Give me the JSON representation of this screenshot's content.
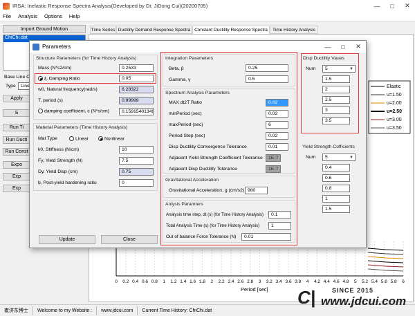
{
  "app": {
    "title": "IRSA: Inelastic Response Spectra Analysis(Developed by Dr. JiDong Cui)(20200705)",
    "menus": [
      "File",
      "Analysis",
      "Options",
      "Help"
    ]
  },
  "left": {
    "import_button": "Import Ground Motion",
    "record": "ChiChi.dat",
    "base_line": "Base Line Co",
    "type_label": "Type",
    "type_value": "Linea",
    "buttons": [
      "Apply",
      "S",
      "Run Ti",
      "Run Ducti",
      "Run Const",
      "Expo",
      "Exp",
      "Exp"
    ]
  },
  "tabs": [
    "Time Series",
    "Ductility Demand Response Spectra",
    "Constant Ductility Response Spectra",
    "Time History Analysis"
  ],
  "tabs_active": "Constant Ductility Response Spectra",
  "chart": {
    "legend": [
      "Elastic",
      "u=1.50",
      "u=2.00",
      "u=2.50",
      "u=3.00",
      "u=3.50"
    ],
    "legend_colors": [
      "#000000",
      "#333333",
      "#e08a00",
      "#000000",
      "#8b1a1a",
      "#555555"
    ],
    "xticks": [
      "0",
      "0.2",
      "0.4",
      "0.6",
      "0.8",
      "1",
      "1.2",
      "1.4",
      "1.6",
      "1.8",
      "2",
      "2.2",
      "2.4",
      "2.6",
      "2.8",
      "3",
      "3.2",
      "3.4",
      "3.6",
      "3.8",
      "4",
      "4.2",
      "4.4",
      "4.6",
      "4.8",
      "5",
      "5.2",
      "5.4",
      "5.6",
      "5.8",
      "6"
    ],
    "xlabel": "Period [sec]"
  },
  "status": {
    "author": "崔济东博士",
    "welcome": "Welcome to my Website :",
    "site": "www.jdcui.com",
    "current": "Current Time History: ChiChi.dat"
  },
  "watermark": {
    "since": "SINCE 2015",
    "url": "www.jdcui.com"
  },
  "dialog": {
    "title": "Parameters",
    "structure": {
      "header": "Structure Parameters (for Time History Analysis)",
      "mass_label": "Mass (N*s2/cm)",
      "mass": "0.2533",
      "damping_label": "ξ, Damping Ratio",
      "damping": "0.05",
      "w0_label": "w0, Natural frequency(rad/s)",
      "w0": "6.28322",
      "T_label": "T, period (s)",
      "T": "0.99999",
      "c_label": "damping coefficient, c (N*s/cm)",
      "c": "0.159154013495"
    },
    "material": {
      "header": "Material Parameters (Time History Analysis)",
      "mattype_label": "Mat Type",
      "linear": "Linear",
      "nonlinear": "Nonlinear",
      "k0_label": "k0, Stiffness (N/cm)",
      "k0": "10",
      "fy_label": "Fy, Yield Strength (N)",
      "fy": "7.5",
      "dy_label": "Dy, Yield Disp (cm)",
      "dy": "0.75",
      "b_label": "b, Post-yield hardening ratio",
      "b": "0"
    },
    "update": "Update",
    "close": "Close",
    "integration": {
      "header": "Integration Parameters",
      "beta_label": "Beta, β",
      "beta": "0.25",
      "gamma_label": "Gamma, γ",
      "gamma": "0.5"
    },
    "spectrum": {
      "header": "Spectrum Analysis Parameters",
      "maxdt_label": "MAX dt2T Ratio",
      "maxdt": "0.02",
      "minp_label": "minPeriod (sec)",
      "minp": "0.02",
      "maxp_label": "maxPeriod (sec)",
      "maxp": "6",
      "step_label": "Period Step (sec)",
      "step": "0.02",
      "dct_label": "Disp Ductility Convergence Tolerance",
      "dct": "0.01",
      "aycct_label": "Adjacent Yield Strength Coefficient Tolerance",
      "aycct": "1E-7",
      "adt_label": "Adjacent Disp Ductility Tolerance",
      "adt": "1E-7"
    },
    "gravity": {
      "header": "Gravitational Acceleration",
      "g_label": "Gravitational Acceleration, g (cm/s2)",
      "g": "980"
    },
    "analysis": {
      "header": "Anlysis Paramters",
      "dt_label": "Analysis time step, dt (s) (for Time History Analysis)",
      "dt": "0.1",
      "total_label": "Total Analysis Time (s) (for Time History Analysis)",
      "total": "1",
      "force_label": "Out of balance Force Tolerance (N)",
      "force": "0.01"
    },
    "disp": {
      "header": "Disp Ductility Vaues",
      "num_label": "Num",
      "num": "5",
      "values": [
        "1.5",
        "2",
        "2.5",
        "3",
        "3.5"
      ]
    },
    "yield": {
      "header": "Yield Strength Cofficients",
      "num_label": "Num",
      "num": "5",
      "values": [
        "0.4",
        "0.6",
        "0.8",
        "1",
        "1.5"
      ]
    }
  }
}
